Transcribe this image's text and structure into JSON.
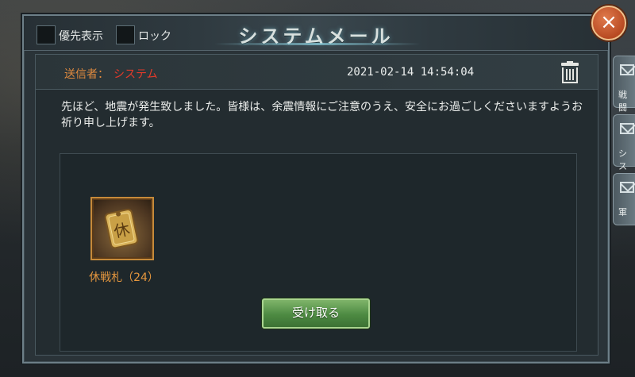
{
  "header": {
    "title": "システムメール",
    "priority_label": "優先表示",
    "lock_label": "ロック",
    "close_glyph": "×"
  },
  "mail": {
    "sender_label": "送信者：",
    "sender_value": "システム",
    "date": "2021-02-14  14:54:04",
    "message": "先ほど、地震が発生致しました。皆様は、余震情報にご注意のうえ、安全にお過ごしくださいますようお祈り申し上げます。"
  },
  "attachment": {
    "item_label": "休戦札（24）",
    "item_glyph": "休",
    "receive_button": "受け取る"
  },
  "side_tabs": [
    "戦闘",
    "シス",
    "軍"
  ],
  "colors": {
    "accent_orange": "#e4963e",
    "sender_red": "#e23a2a",
    "button_green": "#4d8a42",
    "close_orange": "#c85a2c"
  }
}
